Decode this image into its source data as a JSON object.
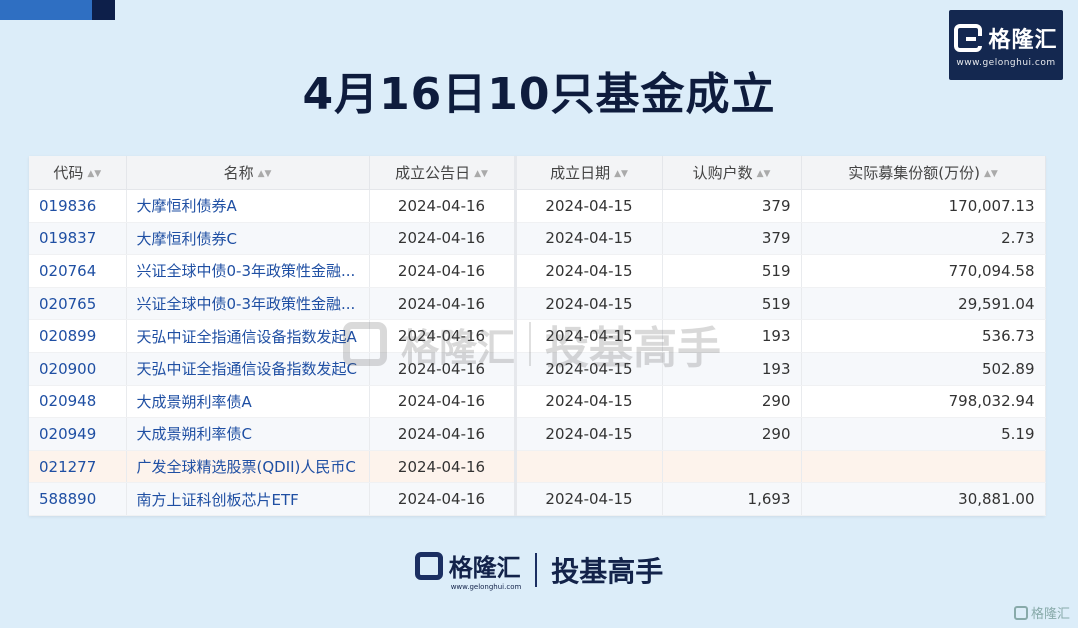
{
  "title": "4月16日10只基金成立",
  "logo": {
    "text": "格隆汇",
    "url": "www.gelonghui.com"
  },
  "table": {
    "headers": [
      "代码",
      "名称",
      "成立公告日",
      "成立日期",
      "认购户数",
      "实际募集份额(万份)"
    ],
    "rows": [
      [
        "019836",
        "大摩恒利债券A",
        "2024-04-16",
        "2024-04-15",
        "379",
        "170,007.13"
      ],
      [
        "019837",
        "大摩恒利债券C",
        "2024-04-16",
        "2024-04-15",
        "379",
        "2.73"
      ],
      [
        "020764",
        "兴证全球中债0-3年政策性金融...",
        "2024-04-16",
        "2024-04-15",
        "519",
        "770,094.58"
      ],
      [
        "020765",
        "兴证全球中债0-3年政策性金融...",
        "2024-04-16",
        "2024-04-15",
        "519",
        "29,591.04"
      ],
      [
        "020899",
        "天弘中证全指通信设备指数发起A",
        "2024-04-16",
        "2024-04-15",
        "193",
        "536.73"
      ],
      [
        "020900",
        "天弘中证全指通信设备指数发起C",
        "2024-04-16",
        "2024-04-15",
        "193",
        "502.89"
      ],
      [
        "020948",
        "大成景朔利率债A",
        "2024-04-16",
        "2024-04-15",
        "290",
        "798,032.94"
      ],
      [
        "020949",
        "大成景朔利率债C",
        "2024-04-16",
        "2024-04-15",
        "290",
        "5.19"
      ],
      [
        "021277",
        "广发全球精选股票(QDII)人民币C",
        "2024-04-16",
        "",
        "",
        ""
      ],
      [
        "588890",
        "南方上证科创板芯片ETF",
        "2024-04-16",
        "2024-04-15",
        "1,693",
        "30,881.00"
      ]
    ]
  },
  "watermark": {
    "text": "格隆汇",
    "sub": "投基高手"
  },
  "footer": {
    "text": "格隆汇",
    "url": "www.gelonghui.com",
    "sub": "投基高手"
  },
  "corner_watermark": "格隆汇",
  "colors": {
    "background": "#dcedf9",
    "link": "#1f4fa3",
    "brand_navy": "#142850"
  }
}
